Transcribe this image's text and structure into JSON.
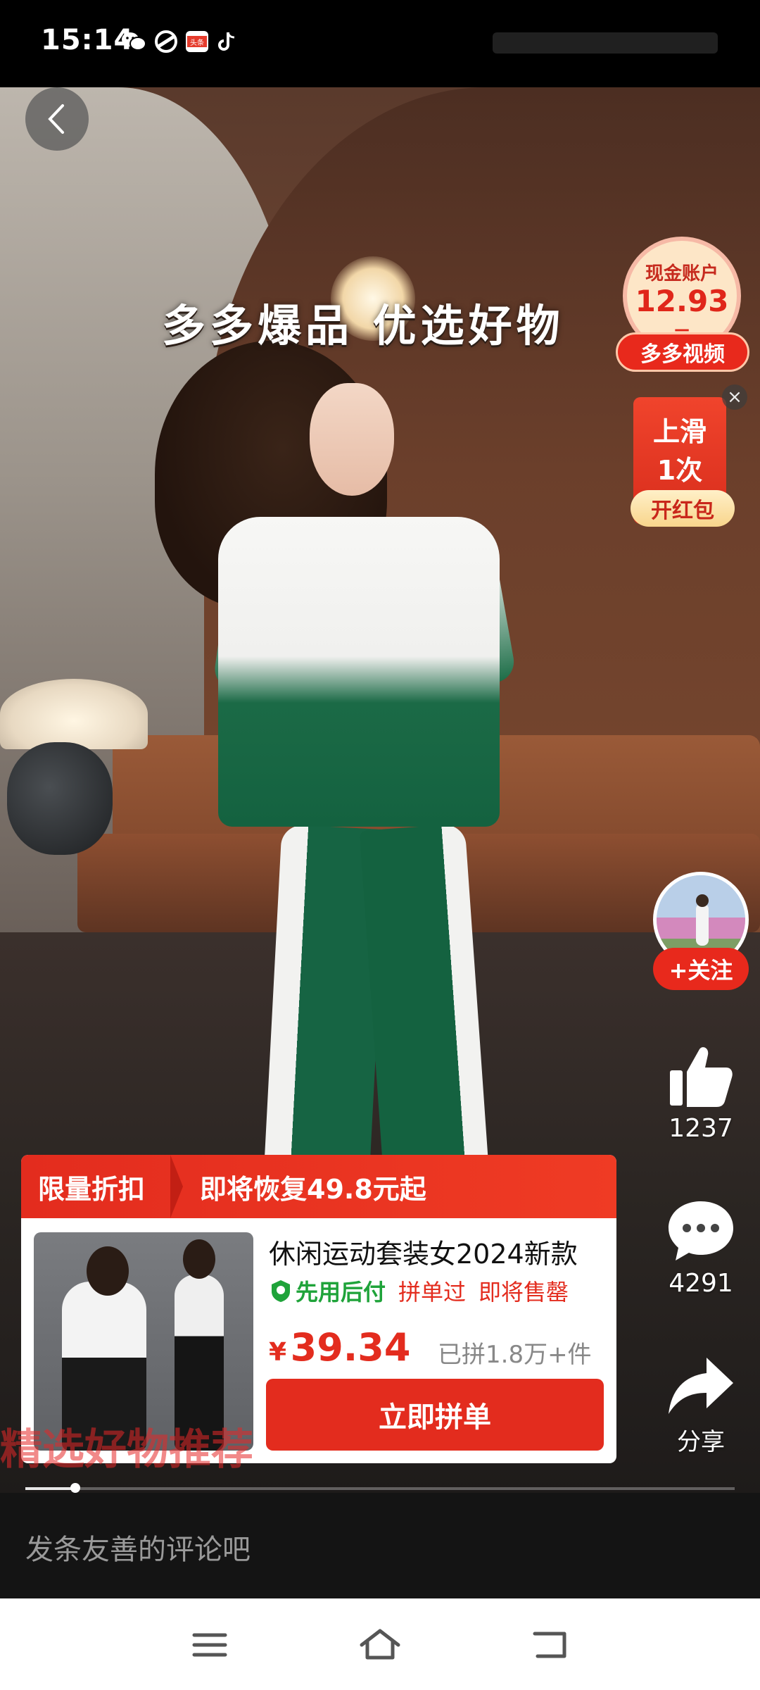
{
  "status_bar": {
    "time": "15:14",
    "icons": [
      "wechat-icon",
      "browser-icon",
      "toutiao-icon",
      "tiktok-icon"
    ],
    "toutiao_label": "头条"
  },
  "video": {
    "slogan": "多多爆品 优选好物",
    "overlay_caption": "精选好物推荐"
  },
  "cash_widget": {
    "label": "现金账户",
    "amount": "12.93",
    "unit": "元",
    "tag": "多多视频"
  },
  "red_packet": {
    "line1": "上滑",
    "line2": "1次",
    "action": "开红包",
    "close": "×"
  },
  "creator": {
    "follow_label": "+关注"
  },
  "actions": {
    "like_count": "1237",
    "comment_count": "4291",
    "share_label": "分享"
  },
  "product_card": {
    "banner_left": "限量折扣",
    "banner_right": "即将恢复49.8元起",
    "title": "休闲运动套装女2024新款",
    "tag_pay_later": "先用后付",
    "tag_group": "拼单过",
    "tag_selling": "即将售罄",
    "price_symbol": "¥",
    "price": "39.34",
    "sold": "已拼1.8万+件",
    "buy_button": "立即拼单"
  },
  "playback": {
    "progress": 0.07
  },
  "comment_bar": {
    "placeholder": "发条友善的评论吧"
  },
  "nav_bar": {
    "buttons": [
      "menu-icon",
      "home-icon",
      "back-icon"
    ]
  },
  "colors": {
    "accent_red": "#e32c1e",
    "pay_later_green": "#1fa33a"
  }
}
